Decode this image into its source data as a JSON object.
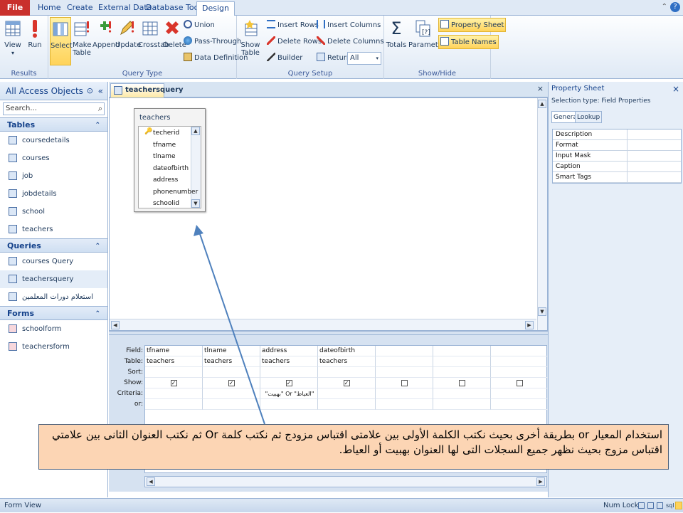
{
  "ribbon_tabs": [
    "File",
    "Home",
    "Create",
    "External Data",
    "Database Tools",
    "Design"
  ],
  "ribbon": {
    "results": {
      "label": "Results",
      "view": "View",
      "run": "Run"
    },
    "query_type": {
      "label": "Query Type",
      "select": "Select",
      "make_table": "Make Table",
      "append": "Append",
      "update": "Update",
      "crosstab": "Crosstab",
      "delete": "Delete",
      "union": "Union",
      "pass_through": "Pass-Through",
      "data_definition": "Data Definition"
    },
    "query_setup": {
      "label": "Query Setup",
      "show_table": "Show Table",
      "insert_rows": "Insert Rows",
      "delete_rows": "Delete Rows",
      "builder": "Builder",
      "insert_columns": "Insert Columns",
      "delete_columns": "Delete Columns",
      "return_label": "Return:",
      "return_value": "All"
    },
    "show_hide": {
      "label": "Show/Hide",
      "totals": "Totals",
      "parameters": "Parameters",
      "property_sheet": "Property Sheet",
      "table_names": "Table Names"
    }
  },
  "nav": {
    "title": "All Access Objects",
    "search_placeholder": "Search...",
    "sections": [
      {
        "name": "Tables",
        "items": [
          "coursedetails",
          "courses",
          "job",
          "jobdetails",
          "school",
          "teachers"
        ]
      },
      {
        "name": "Queries",
        "items": [
          "courses Query",
          "teachersquery",
          "استعلام دورات المعلمين"
        ]
      },
      {
        "name": "Forms",
        "items": [
          "schoolform",
          "teachersform"
        ]
      }
    ]
  },
  "document": {
    "tab": "teachersquery",
    "table_box": {
      "title": "teachers",
      "fields": [
        "techerid",
        "tfname",
        "tlname",
        "dateofbirth",
        "address",
        "phonenumber",
        "schoolid"
      ]
    },
    "grid": {
      "row_labels": [
        "Field:",
        "Table:",
        "Sort:",
        "Show:",
        "Criteria:",
        "or:"
      ],
      "columns": [
        {
          "field": "tfname",
          "table": "teachers",
          "show": true,
          "criteria": ""
        },
        {
          "field": "tlname",
          "table": "teachers",
          "show": true,
          "criteria": ""
        },
        {
          "field": "address",
          "table": "teachers",
          "show": true,
          "criteria": "\"العياط\" Or \"بهبيت\""
        },
        {
          "field": "dateofbirth",
          "table": "teachers",
          "show": true,
          "criteria": ""
        },
        {
          "field": "",
          "table": "",
          "show": false,
          "criteria": ""
        },
        {
          "field": "",
          "table": "",
          "show": false,
          "criteria": ""
        },
        {
          "field": "",
          "table": "",
          "show": false,
          "criteria": ""
        }
      ]
    }
  },
  "property_sheet": {
    "title": "Property Sheet",
    "selection_type": "Selection type:  Field Properties",
    "tabs": [
      "General",
      "Lookup"
    ],
    "rows": [
      "Description",
      "Format",
      "Input Mask",
      "Caption",
      "Smart Tags"
    ]
  },
  "status": {
    "left": "Form View",
    "num_lock": "Num Lock"
  },
  "annotation": "استخدام المعيار or بطريقة أخرى بحيث نكتب الكلمة الأولى بين علامتى اقتباس مزودج ثم نكتب كلمة Or ثم نكتب العنوان الثانى بين علامتي اقتباس مزوج  بحيث نظهر جميع السجلات التى لها العنوان بهبيت أو العياط.",
  "colors": {
    "file_tab": "#c9302c",
    "accent": "#15428b",
    "callout_bg": "#fcd5b4",
    "arrow": "#4f81bd"
  }
}
